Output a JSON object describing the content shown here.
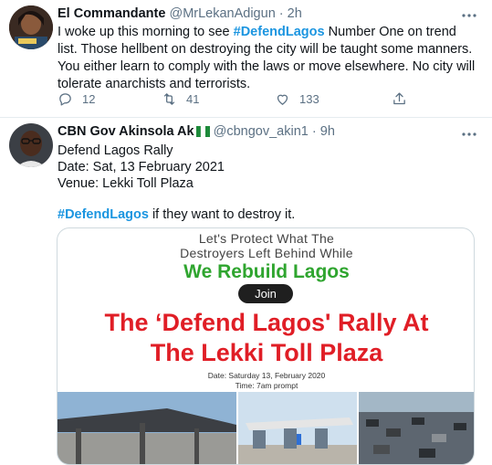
{
  "tweets": [
    {
      "author": "El Commandante",
      "handle": "@MrLekanAdigun",
      "separator": "·",
      "time": "2h",
      "text_before": "I woke up this morning to see ",
      "hashtag": "#DefendLagos",
      "text_after": " Number One on trend list. Those hellbent on destroying the city will be taught some manners. You either learn to comply with the laws or move elsewhere. No city will tolerate anarchists and terrorists.",
      "avatar_icon": "profile-photo",
      "actions": {
        "reply_count": "12",
        "retweet_count": "41",
        "like_count": "133"
      }
    },
    {
      "author": "CBN Gov Akinsola Ak",
      "flag_icon": "nigeria-flag-icon",
      "handle": "@cbngov_akin1",
      "separator": "·",
      "time": "9h",
      "lines": [
        "Defend Lagos Rally",
        "Date: Sat, 13 February 2021",
        "Venue: Lekki Toll Plaza"
      ],
      "hashtag": "#DefendLagos",
      "hashtag_after": " if they want to destroy it.",
      "poster": {
        "line1": "Let's Protect What The",
        "line2": "Destroyers Left Behind While",
        "green": "We Rebuild Lagos",
        "join": "Join",
        "red1": "The ‘Defend Lagos' Rally At",
        "red2": "The Lekki Toll Plaza",
        "date": "Date: Saturday 13, February 2020",
        "time": "Time: 7am prompt"
      }
    }
  ],
  "colors": {
    "link": "#1b95e0",
    "muted": "#5b7083",
    "poster_green": "#2fa52f",
    "poster_red": "#e01e26"
  },
  "icons": [
    "more-icon",
    "reply-icon",
    "retweet-icon",
    "like-icon",
    "share-icon"
  ]
}
